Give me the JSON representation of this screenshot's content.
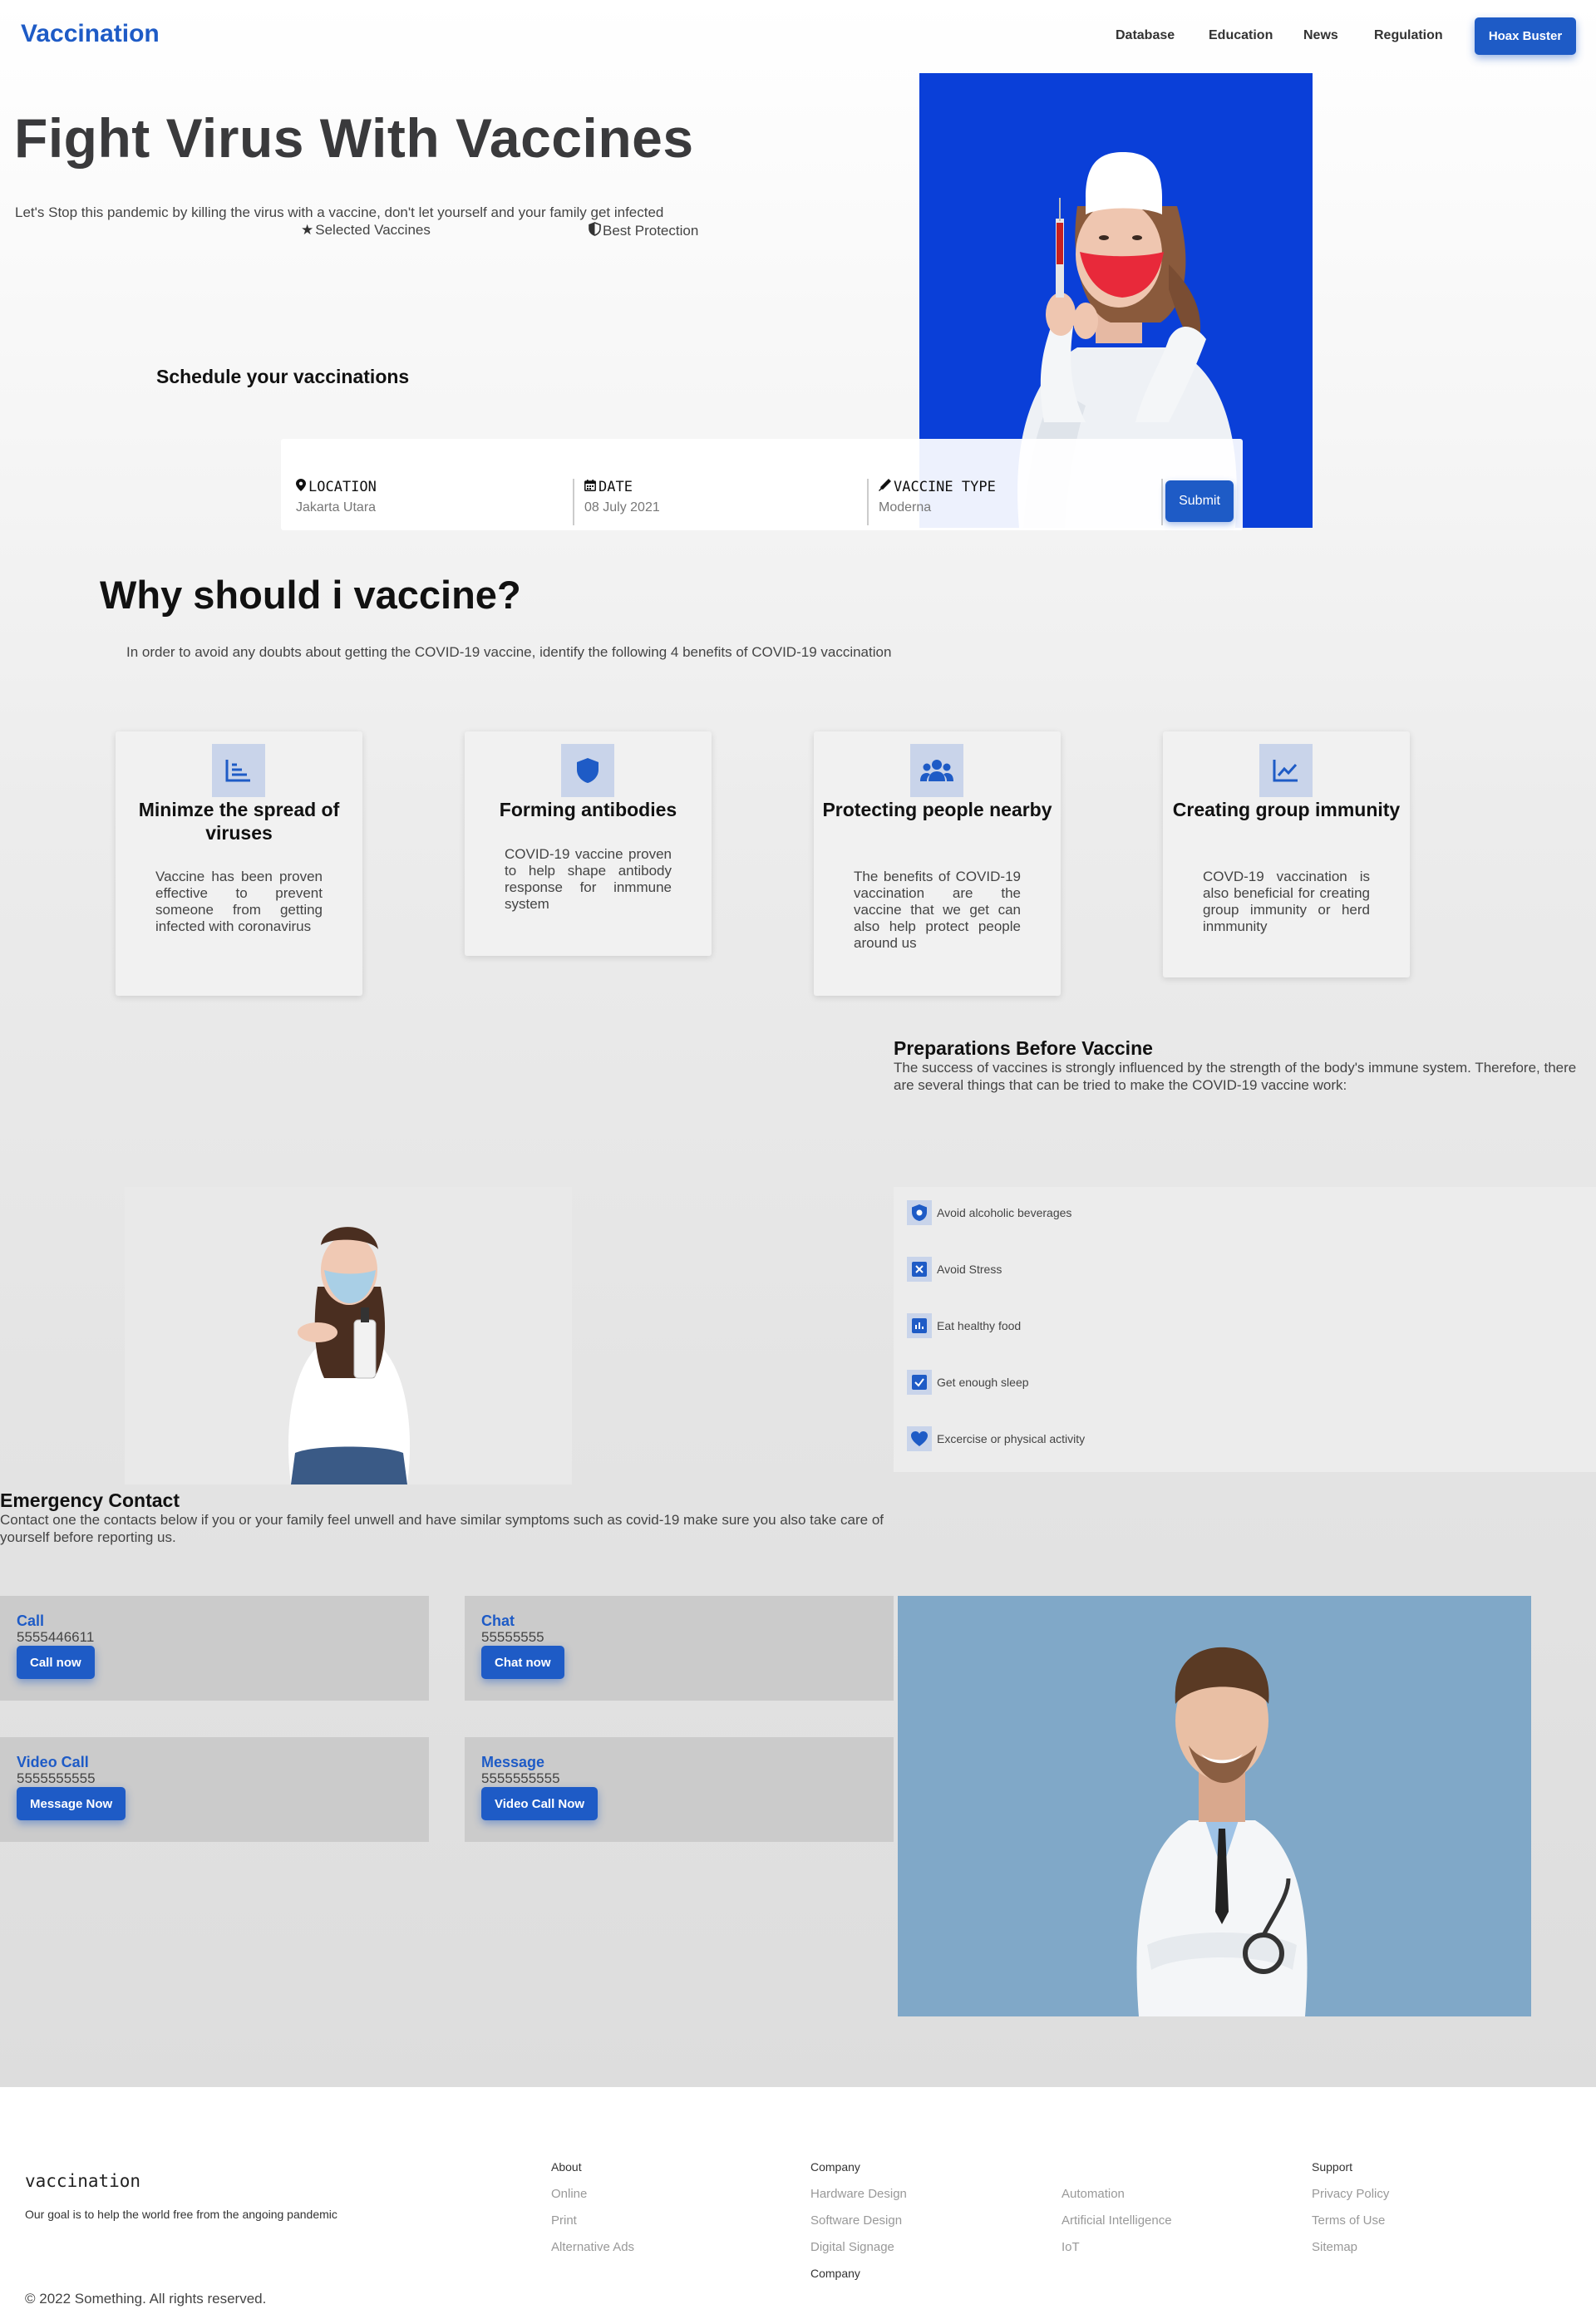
{
  "nav": {
    "brand": "Vaccination",
    "links": [
      "Database",
      "Education",
      "News",
      "Regulation"
    ],
    "cta": "Hoax Buster"
  },
  "hero": {
    "title": "Fight Virus With Vaccines",
    "subtitle": "Let's Stop this pandemic by killing the virus with a vaccine, don't let yourself and your family get infected",
    "feature1": "Selected Vaccines",
    "feature2": "Best Protection"
  },
  "schedule": {
    "title": "Schedule your vaccinations",
    "location_label": "LOCATION",
    "location_value": "Jakarta Utara",
    "date_label": "DATE",
    "date_value": "08 July 2021",
    "type_label": "VACCINE TYPE",
    "type_value": "Moderna",
    "submit": "Submit"
  },
  "why": {
    "title": "Why should i vaccine?",
    "subtitle": "In order to avoid any doubts about getting the COVID-19 vaccine, identify the following 4 benefits of COVID-19 vaccination",
    "cards": [
      {
        "title": "Minimze the spread of viruses",
        "text": "Vaccine has been proven effective to prevent someone from getting infected with coronavirus",
        "icon": "stairs-chart-icon"
      },
      {
        "title": "Forming antibodies",
        "text": "COVID-19 vaccine proven to help shape antibody response for inmmune system",
        "icon": "shield-icon"
      },
      {
        "title": "Protecting people nearby",
        "text": "The benefits of COVID-19 vaccination are the vaccine that we get can also help protect people around us",
        "icon": "people-icon"
      },
      {
        "title": "Creating group immunity",
        "text": "COVD-19 vaccination is also beneficial for creating group immunity or herd inmmunity",
        "icon": "line-chart-icon"
      }
    ]
  },
  "prep": {
    "title": "Preparations Before Vaccine",
    "text": "The success of vaccines is strongly influenced by the strength of the body's immune system. Therefore, there are several things that can be tried to make the COVID-19 vaccine work:",
    "items": [
      {
        "label": "Avoid alcoholic beverages",
        "icon": "shield-virus-icon"
      },
      {
        "label": "Avoid Stress",
        "icon": "x-box-icon"
      },
      {
        "label": "Eat healthy food",
        "icon": "bar-chart-icon"
      },
      {
        "label": "Get enough sleep",
        "icon": "check-box-icon"
      },
      {
        "label": "Excercise or physical activity",
        "icon": "heart-icon"
      }
    ]
  },
  "emergency": {
    "title": "Emergency Contact",
    "text": "Contact one the contacts below if you or your family feel unwell and have similar symptoms such as covid-19 make sure you also take care of yourself before reporting us.",
    "contacts": [
      {
        "title": "Call",
        "number": "5555446611",
        "button": "Call now"
      },
      {
        "title": "Chat",
        "number": "55555555",
        "button": "Chat now"
      },
      {
        "title": "Video Call",
        "number": "5555555555",
        "button": "Message Now"
      },
      {
        "title": "Message",
        "number": "5555555555",
        "button": "Video Call Now"
      }
    ]
  },
  "footer": {
    "brand": "vaccination",
    "goal": "Our goal is to help the world free from the angoing pandemic",
    "copyright": "© 2022 Something. All rights reserved.",
    "col_about": {
      "head": "About",
      "links": [
        "Online",
        "Print",
        "Alternative Ads"
      ]
    },
    "col_company": {
      "head": "Company",
      "links": [
        "Hardware Design",
        "Software Design",
        "Digital Signage"
      ],
      "extra": "Company"
    },
    "col_tech": {
      "links": [
        "Automation",
        "Artificial Intelligence",
        "IoT"
      ]
    },
    "col_support": {
      "head": "Support",
      "links": [
        "Privacy Policy",
        "Terms of Use",
        "Sitemap"
      ]
    }
  },
  "colors": {
    "accent": "#1e5bc6",
    "hero_bg": "#0a3fd8",
    "icon_bg": "#c9d4ea"
  }
}
